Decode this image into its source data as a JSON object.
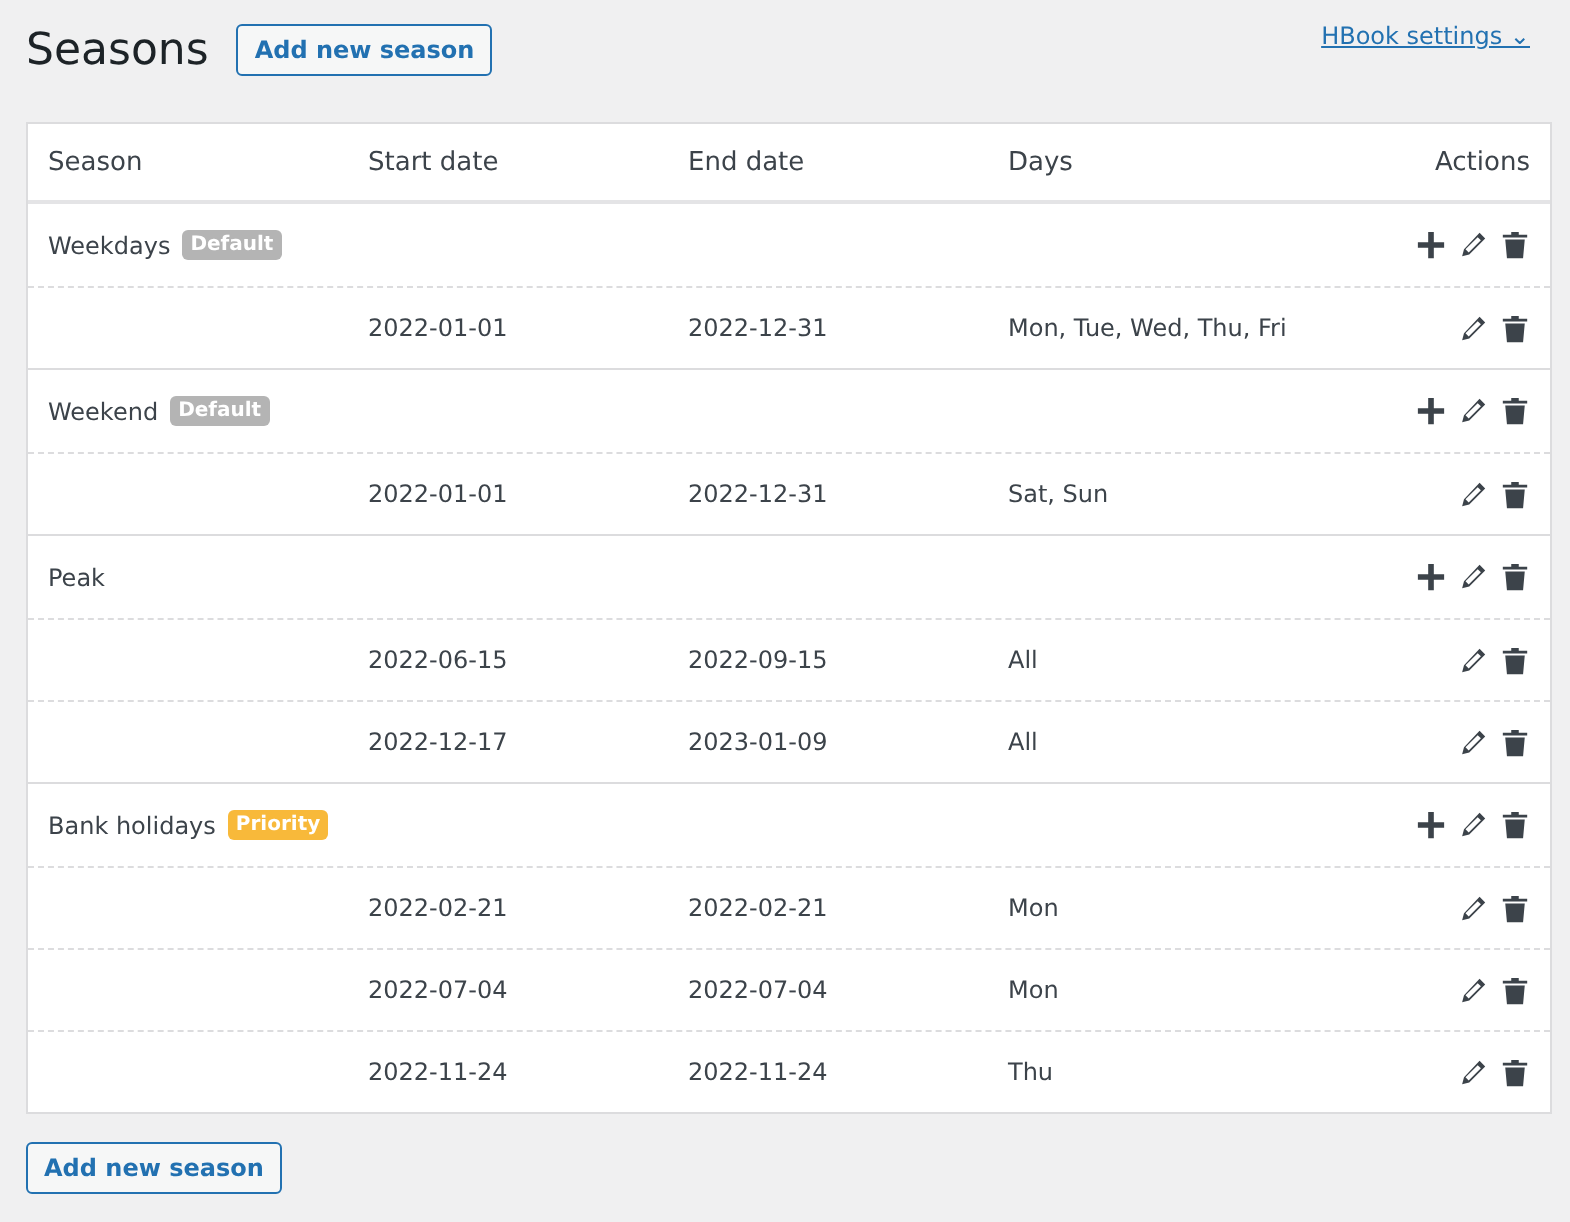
{
  "title": "Seasons",
  "add_button_top": "Add new season",
  "settings_link": "HBook settings",
  "settings_caret": "⌄",
  "columns": [
    "Season",
    "Start date",
    "End date",
    "Days",
    "Actions"
  ],
  "seasons": [
    {
      "name": "Weekdays",
      "badge": {
        "text": "Default",
        "kind": "default"
      },
      "periods": [
        {
          "start": "2022-01-01",
          "end": "2022-12-31",
          "days": "Mon, Tue, Wed, Thu, Fri"
        }
      ]
    },
    {
      "name": "Weekend",
      "badge": {
        "text": "Default",
        "kind": "default"
      },
      "periods": [
        {
          "start": "2022-01-01",
          "end": "2022-12-31",
          "days": "Sat, Sun"
        }
      ]
    },
    {
      "name": "Peak",
      "periods": [
        {
          "start": "2022-06-15",
          "end": "2022-09-15",
          "days": "All"
        },
        {
          "start": "2022-12-17",
          "end": "2023-01-09",
          "days": "All"
        }
      ]
    },
    {
      "name": "Bank holidays",
      "badge": {
        "text": "Priority",
        "kind": "priority"
      },
      "periods": [
        {
          "start": "2022-02-21",
          "end": "2022-02-21",
          "days": "Mon"
        },
        {
          "start": "2022-07-04",
          "end": "2022-07-04",
          "days": "Mon"
        },
        {
          "start": "2022-11-24",
          "end": "2022-11-24",
          "days": "Thu"
        }
      ]
    }
  ],
  "add_button_bottom": "Add new season"
}
